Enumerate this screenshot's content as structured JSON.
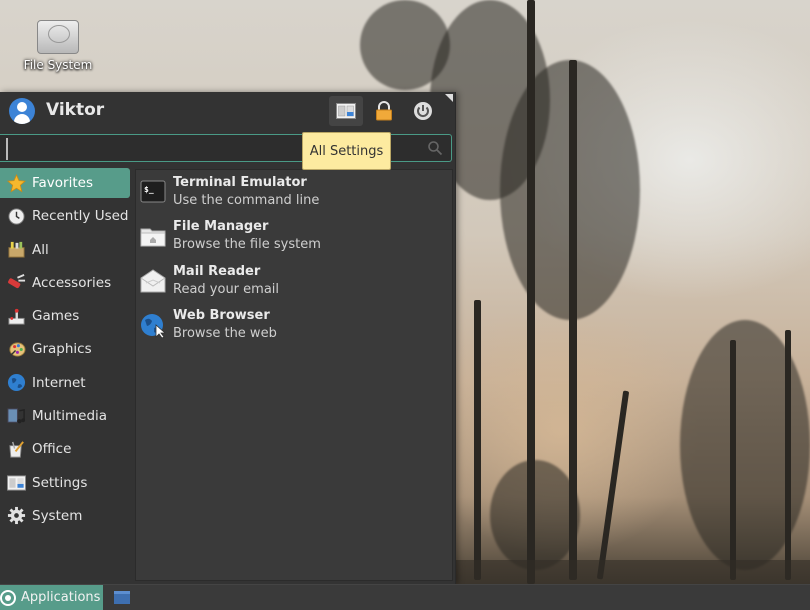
{
  "desktop": {
    "icons": [
      {
        "label": "File System",
        "icon": "hard-drive-icon"
      }
    ]
  },
  "menu": {
    "user": {
      "name": "Viktor",
      "avatar_icon": "user-avatar-icon",
      "avatar_color": "#3c83d6"
    },
    "header_buttons": [
      {
        "id": "all-settings",
        "icon": "settings-manager-icon",
        "tooltip": "All Settings"
      },
      {
        "id": "lock",
        "icon": "lock-icon"
      },
      {
        "id": "power",
        "icon": "power-icon"
      }
    ],
    "search": {
      "value": "",
      "placeholder": "",
      "icon": "search-icon"
    },
    "tooltip": "All Settings",
    "categories": [
      {
        "label": "Favorites",
        "icon": "star-icon",
        "active": true
      },
      {
        "label": "Recently Used",
        "icon": "clock-icon"
      },
      {
        "label": "All",
        "icon": "all-apps-icon"
      },
      {
        "label": "Accessories",
        "icon": "accessories-icon"
      },
      {
        "label": "Games",
        "icon": "joystick-icon"
      },
      {
        "label": "Graphics",
        "icon": "palette-icon"
      },
      {
        "label": "Internet",
        "icon": "globe-icon"
      },
      {
        "label": "Multimedia",
        "icon": "multimedia-icon"
      },
      {
        "label": "Office",
        "icon": "office-icon"
      },
      {
        "label": "Settings",
        "icon": "settings-icon"
      },
      {
        "label": "System",
        "icon": "gear-icon"
      }
    ],
    "apps": [
      {
        "name": "Terminal Emulator",
        "description": "Use the command line",
        "icon": "terminal-icon"
      },
      {
        "name": "File Manager",
        "description": "Browse the file system",
        "icon": "folder-icon"
      },
      {
        "name": "Mail Reader",
        "description": "Read your email",
        "icon": "mail-icon"
      },
      {
        "name": "Web Browser",
        "description": "Browse the web",
        "icon": "web-browser-icon"
      }
    ]
  },
  "taskbar": {
    "applications_label": "Applications",
    "show_desktop_icon": "show-desktop-icon"
  },
  "colors": {
    "accent": "#579c8a",
    "menu_bg": "#333333",
    "tooltip_bg": "#fdeba0"
  }
}
